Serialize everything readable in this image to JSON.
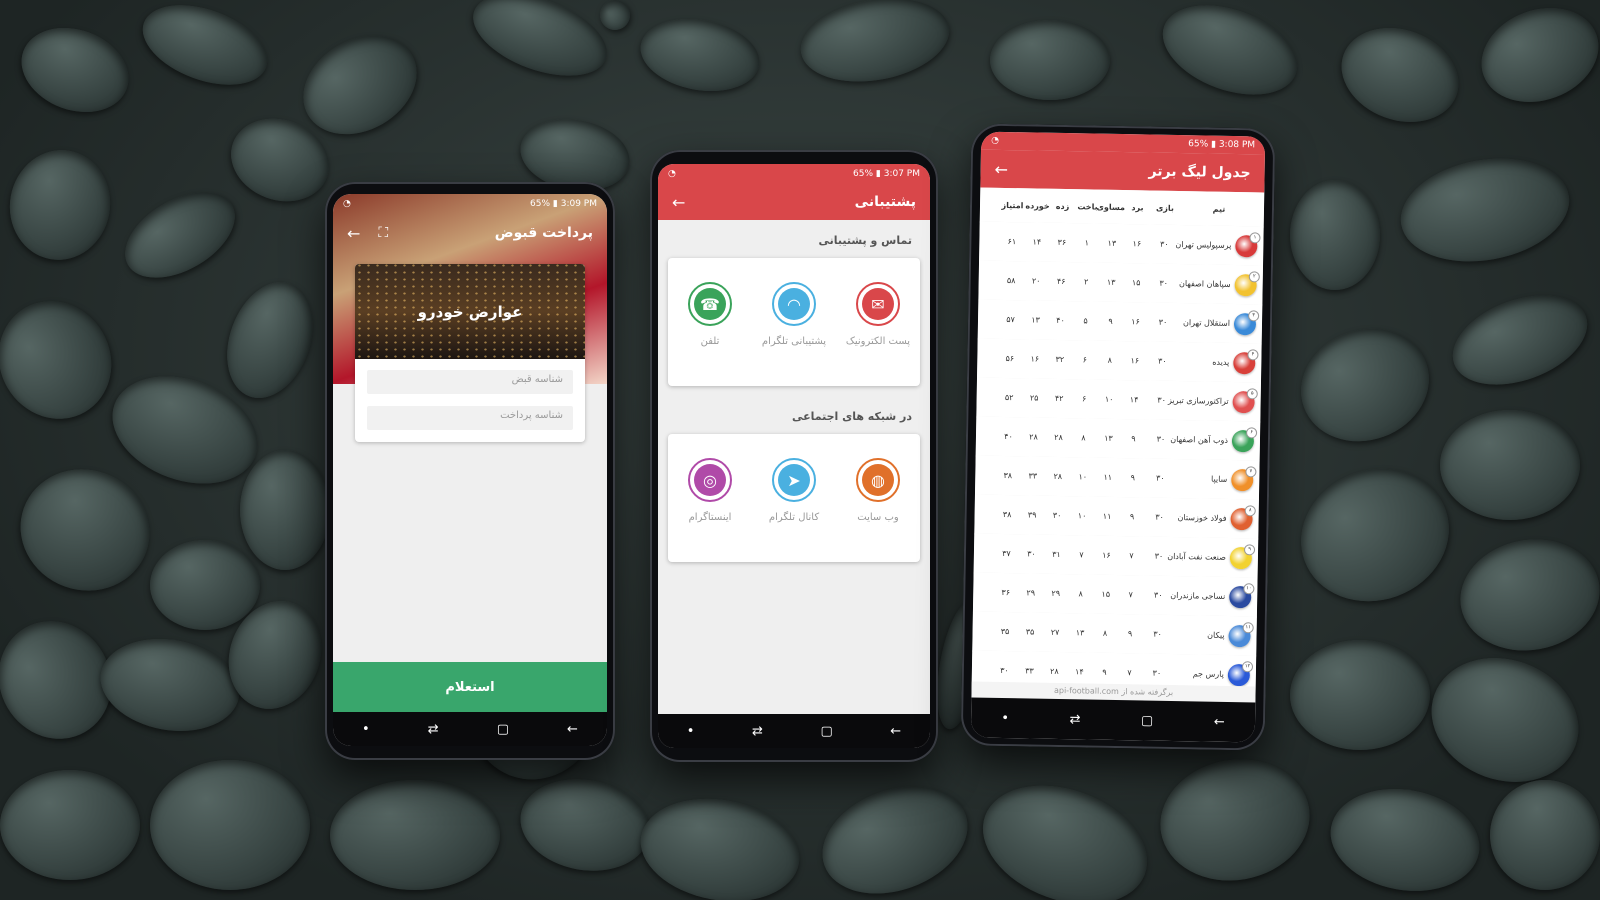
{
  "phone1": {
    "status_time": "3:09 PM",
    "status_battery": "65%",
    "title": "پرداخت قبوض",
    "back_icon": "arrow-left-icon",
    "scan_icon": "barcode-scan-icon",
    "banner_text": "عوارض خودرو",
    "field_bill_id": "شناسه قبض",
    "field_payment_id": "شناسه پرداخت",
    "submit": "استعلام"
  },
  "phone2": {
    "status_time": "3:07 PM",
    "status_battery": "65%",
    "title": "پشتیبانی",
    "section_contact": "تماس و پشتیبانی",
    "section_social": "در شبکه های اجتماعی",
    "contact_items": [
      {
        "label": "پست الکترونیک",
        "icon": "email-icon",
        "color": "#d9474a"
      },
      {
        "label": "پشتیبانی تلگرام",
        "icon": "headset-icon",
        "color": "#4ab0e0"
      },
      {
        "label": "تلفن",
        "icon": "phone-icon",
        "color": "#3aa35a"
      }
    ],
    "social_items": [
      {
        "label": "وب سایت",
        "icon": "globe-icon",
        "color": "#e0702a"
      },
      {
        "label": "کانال تلگرام",
        "icon": "telegram-icon",
        "color": "#4ab0e0"
      },
      {
        "label": "اینستاگرام",
        "icon": "instagram-icon",
        "color": "#b04aa8"
      }
    ]
  },
  "phone3": {
    "status_time": "3:08 PM",
    "status_battery": "65%",
    "title": "جدول لیگ برتر",
    "headers": {
      "team": "تیم",
      "played": "بازی",
      "won": "برد",
      "drawn": "مساوی",
      "lost": "باخت",
      "gf": "زده",
      "ga": "خورده",
      "points": "امتیاز"
    },
    "rows": [
      {
        "rank": "۱",
        "team": "پرسپولیس تهران",
        "played": "۳۰",
        "won": "۱۶",
        "drawn": "۱۳",
        "lost": "۱",
        "gf": "۳۶",
        "ga": "۱۴",
        "points": "۶۱",
        "color": "#d83a3a"
      },
      {
        "rank": "۲",
        "team": "سپاهان اصفهان",
        "played": "۳۰",
        "won": "۱۵",
        "drawn": "۱۳",
        "lost": "۲",
        "gf": "۴۶",
        "ga": "۲۰",
        "points": "۵۸",
        "color": "#f2c230"
      },
      {
        "rank": "۳",
        "team": "استقلال تهران",
        "played": "۳۰",
        "won": "۱۶",
        "drawn": "۹",
        "lost": "۵",
        "gf": "۴۰",
        "ga": "۱۳",
        "points": "۵۷",
        "color": "#3a8ad8"
      },
      {
        "rank": "۴",
        "team": "پدیده",
        "played": "۳۰",
        "won": "۱۶",
        "drawn": "۸",
        "lost": "۶",
        "gf": "۳۲",
        "ga": "۱۶",
        "points": "۵۶",
        "color": "#d8403a"
      },
      {
        "rank": "۵",
        "team": "تراکتورسازی تبریز",
        "played": "۳۰",
        "won": "۱۴",
        "drawn": "۱۰",
        "lost": "۶",
        "gf": "۴۲",
        "ga": "۲۵",
        "points": "۵۲",
        "color": "#e05050"
      },
      {
        "rank": "۶",
        "team": "ذوب آهن اصفهان",
        "played": "۳۰",
        "won": "۹",
        "drawn": "۱۳",
        "lost": "۸",
        "gf": "۲۸",
        "ga": "۲۸",
        "points": "۴۰",
        "color": "#3aa35a"
      },
      {
        "rank": "۷",
        "team": "سایپا",
        "played": "۳۰",
        "won": "۹",
        "drawn": "۱۱",
        "lost": "۱۰",
        "gf": "۲۸",
        "ga": "۳۳",
        "points": "۳۸",
        "color": "#f0902a"
      },
      {
        "rank": "۸",
        "team": "فولاد خوزستان",
        "played": "۳۰",
        "won": "۹",
        "drawn": "۱۱",
        "lost": "۱۰",
        "gf": "۳۰",
        "ga": "۳۹",
        "points": "۳۸",
        "color": "#e06030"
      },
      {
        "rank": "۹",
        "team": "صنعت نفت آبادان",
        "played": "۳۰",
        "won": "۷",
        "drawn": "۱۶",
        "lost": "۷",
        "gf": "۳۱",
        "ga": "۳۰",
        "points": "۳۷",
        "color": "#f2d230"
      },
      {
        "rank": "۱۰",
        "team": "نساجی مازندران",
        "played": "۳۰",
        "won": "۷",
        "drawn": "۱۵",
        "lost": "۸",
        "gf": "۲۹",
        "ga": "۲۹",
        "points": "۳۶",
        "color": "#2a4aa0"
      },
      {
        "rank": "۱۱",
        "team": "پیکان",
        "played": "۳۰",
        "won": "۹",
        "drawn": "۸",
        "lost": "۱۳",
        "gf": "۲۷",
        "ga": "۳۵",
        "points": "۳۵",
        "color": "#4a8ad8"
      },
      {
        "rank": "۱۲",
        "team": "پارس جم",
        "played": "۳۰",
        "won": "۷",
        "drawn": "۹",
        "lost": "۱۴",
        "gf": "۲۸",
        "ga": "۳۳",
        "points": "۳۰",
        "color": "#2a5ad8"
      }
    ],
    "footer": "برگرفته شده از api-football.com"
  }
}
